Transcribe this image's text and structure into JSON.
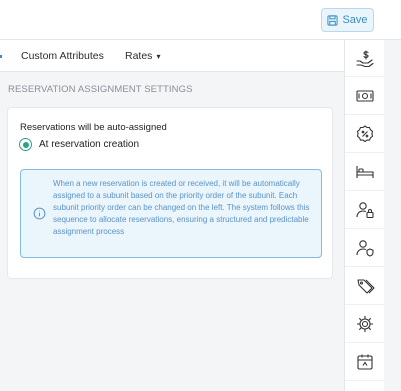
{
  "toolbar": {
    "save_label": "Save",
    "save_icon": "save-icon"
  },
  "tabs": [
    {
      "label": "Custom Attributes"
    },
    {
      "label": "Rates",
      "has_dropdown": true
    }
  ],
  "section": {
    "title": "RESERVATION ASSIGNMENT SETTINGS"
  },
  "assignment": {
    "label": "Reservations will be auto-assigned",
    "option_label": "At reservation creation",
    "option_selected": true
  },
  "info": {
    "icon": "info-icon",
    "text": "When a new reservation is created or received, it will be automatically assigned to a subunit based on the priority order of the subunit. Each subunit priority order can be changed on the left. The system follows this sequence to allocate reservations, ensuring a structured and predictable assignment process"
  },
  "rail_icons": [
    "hand-dollar-icon",
    "cash-icon",
    "discount-badge-icon",
    "bed-icon",
    "user-lock-icon",
    "user-shield-icon",
    "tags-icon",
    "settings-gear-icon",
    "calendar-icon"
  ],
  "colors": {
    "accent": "#2aa38a",
    "info_border": "#7fbde3",
    "info_bg": "#eaf5fc",
    "info_text": "#5a93c9",
    "save_text": "#3a8fc4"
  }
}
